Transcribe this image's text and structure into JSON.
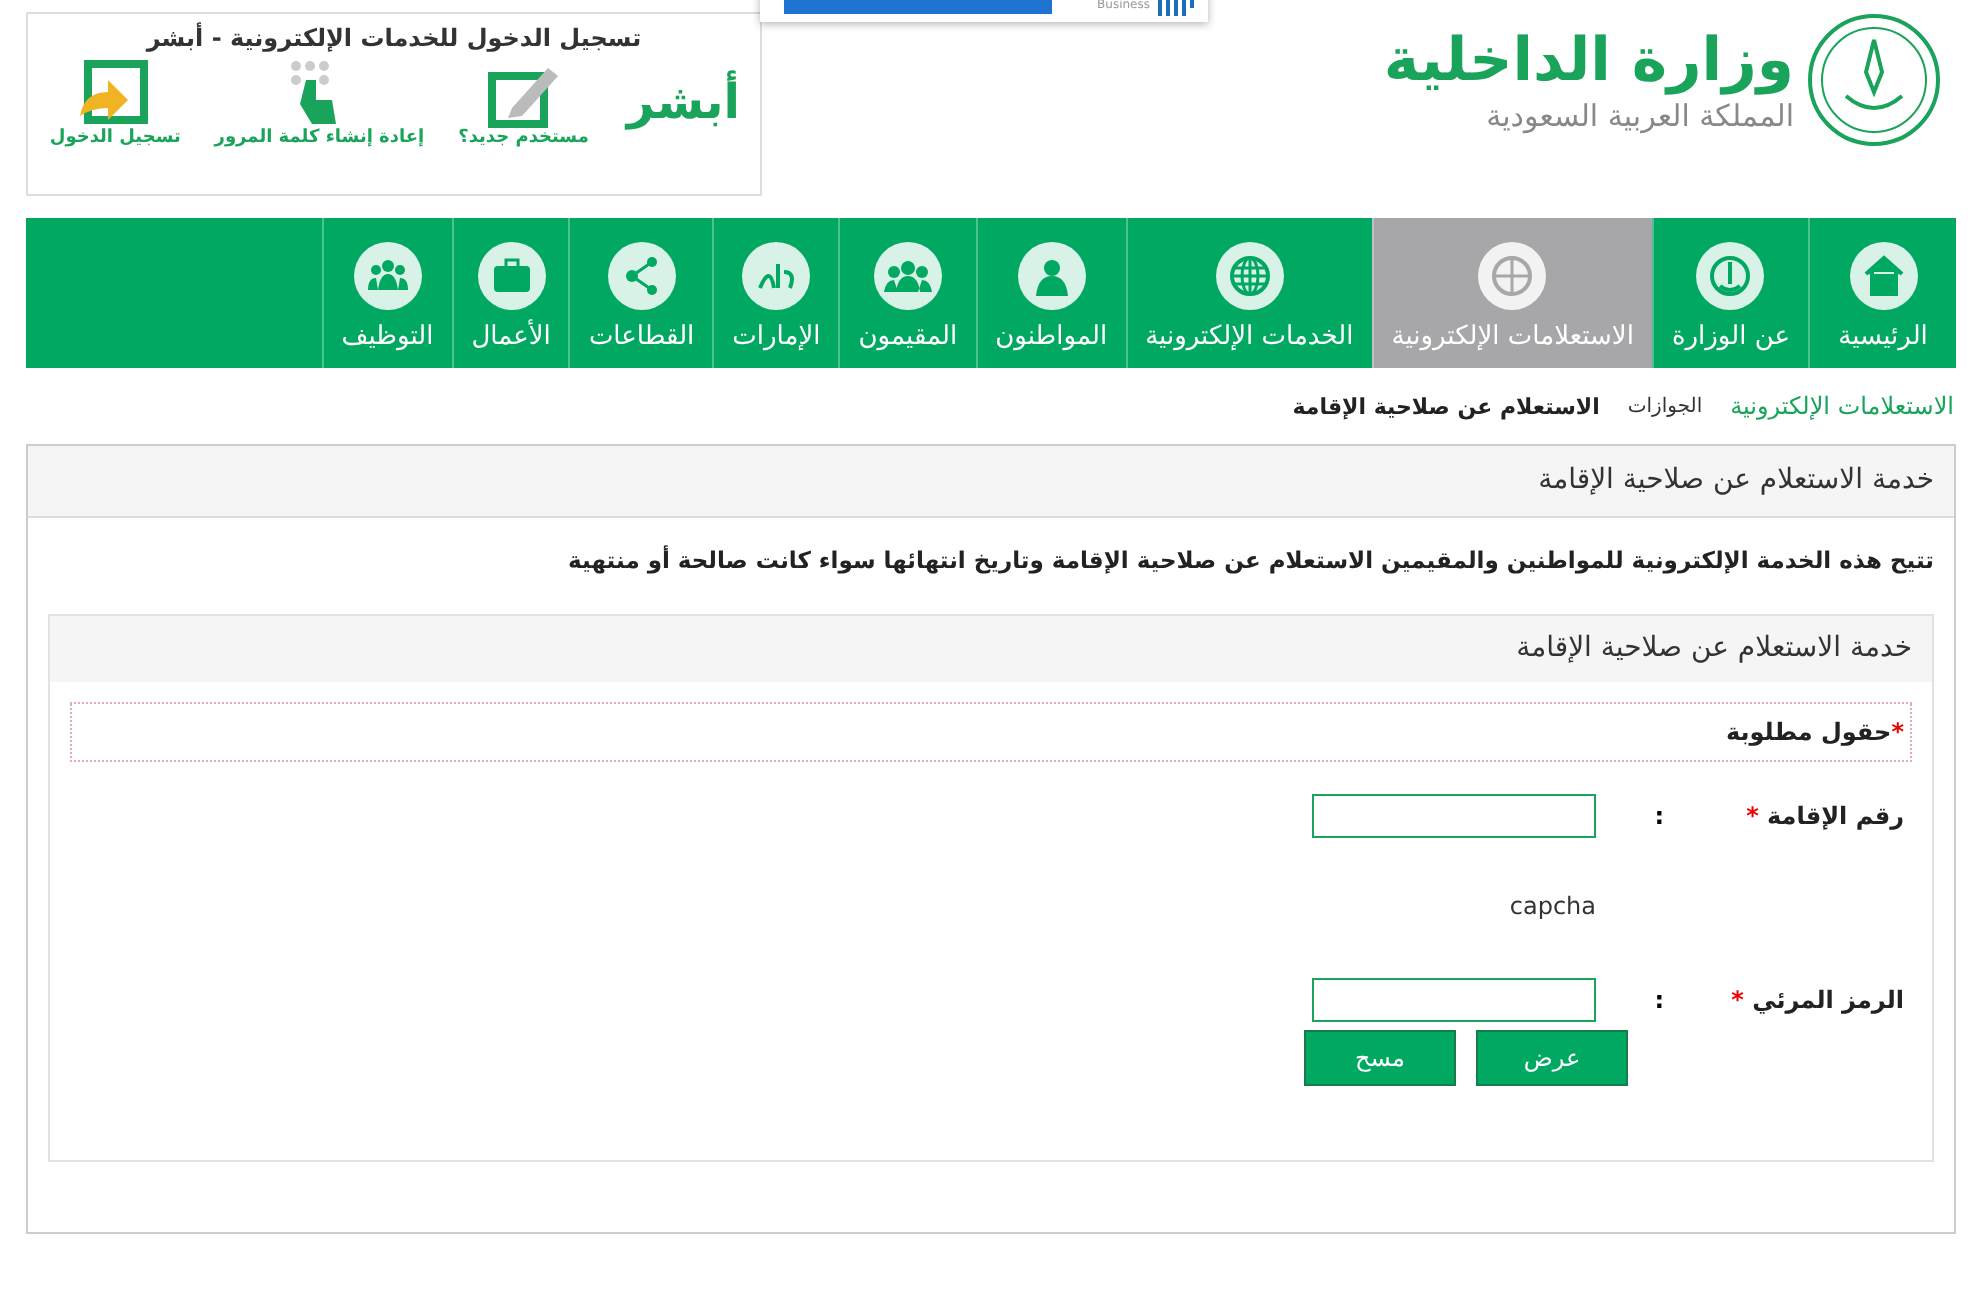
{
  "header": {
    "ministry_name": "وزارة الداخلية",
    "country": "المملكة العربية السعودية"
  },
  "popup": {
    "label": "Business"
  },
  "login_box": {
    "title": "تسجيل الدخول للخدمات الإلكترونية - أبشر",
    "logo_text": "أبشر",
    "actions": [
      {
        "label": "مستخدم جديد؟"
      },
      {
        "label": "إعادة إنشاء كلمة المرور"
      },
      {
        "label": "تسجيل الدخول"
      }
    ]
  },
  "nav": [
    {
      "label": "الرئيسية",
      "selected": false
    },
    {
      "label": "عن الوزارة",
      "selected": false
    },
    {
      "label": "الاستعلامات الإلكترونية",
      "selected": true
    },
    {
      "label": "الخدمات الإلكترونية",
      "selected": false
    },
    {
      "label": "المواطنون",
      "selected": false
    },
    {
      "label": "المقيمون",
      "selected": false
    },
    {
      "label": "الإمارات",
      "selected": false
    },
    {
      "label": "القطاعات",
      "selected": false
    },
    {
      "label": "الأعمال",
      "selected": false
    },
    {
      "label": "التوظيف",
      "selected": false
    }
  ],
  "breadcrumb": [
    {
      "label": "الاستعلامات الإلكترونية",
      "kind": "link"
    },
    {
      "label": "الجوازات",
      "kind": "section"
    },
    {
      "label": "الاستعلام عن صلاحية الإقامة",
      "kind": "current"
    }
  ],
  "panel": {
    "title": "خدمة الاستعلام عن صلاحية الإقامة",
    "description": "تتيح هذه الخدمة الإلكترونية للمواطنين والمقيمين الاستعلام عن صلاحية الإقامة وتاريخ انتهائها سواء كانت صالحة أو منتهية",
    "form": {
      "title": "خدمة الاستعلام عن صلاحية الإقامة",
      "required_note": "حقول مطلوبة",
      "required_mark": "*",
      "fields": [
        {
          "kind": "input",
          "label": "رقم الإقامة",
          "required": true,
          "separator": ":"
        },
        {
          "kind": "image",
          "text": "capcha"
        },
        {
          "kind": "input",
          "label": "الرمز المرئي",
          "required": true,
          "separator": ":"
        }
      ],
      "buttons": [
        {
          "label": "عرض"
        },
        {
          "label": "مسح"
        }
      ]
    }
  }
}
